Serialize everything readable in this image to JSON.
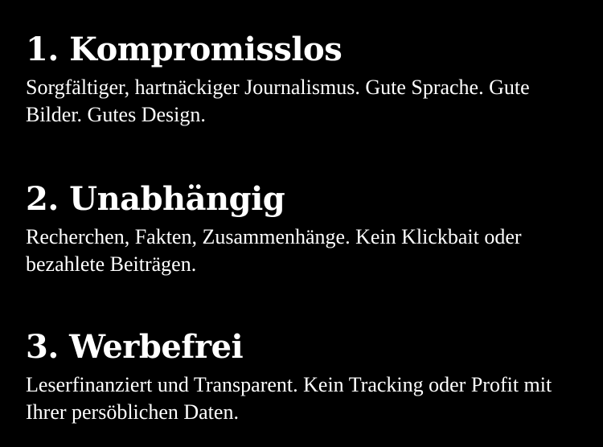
{
  "items": [
    {
      "heading": "1. Kompromisslos",
      "text": "Sorgfältiger, hartnäckiger Journalismus. Gute Sprache. Gute Bilder. Gutes Design."
    },
    {
      "heading": "2. Unabhängig",
      "text": "Recherchen, Fakten, Zusammenhänge. Kein Klickbait oder bezahlete Beiträgen."
    },
    {
      "heading": "3. Werbefrei",
      "text": "Leserfinanziert und Transparent. Kein Tracking oder Profit mit Ihrer persöblichen Daten."
    }
  ],
  "colors": {
    "background": "#000000",
    "text": "#ffffff"
  }
}
